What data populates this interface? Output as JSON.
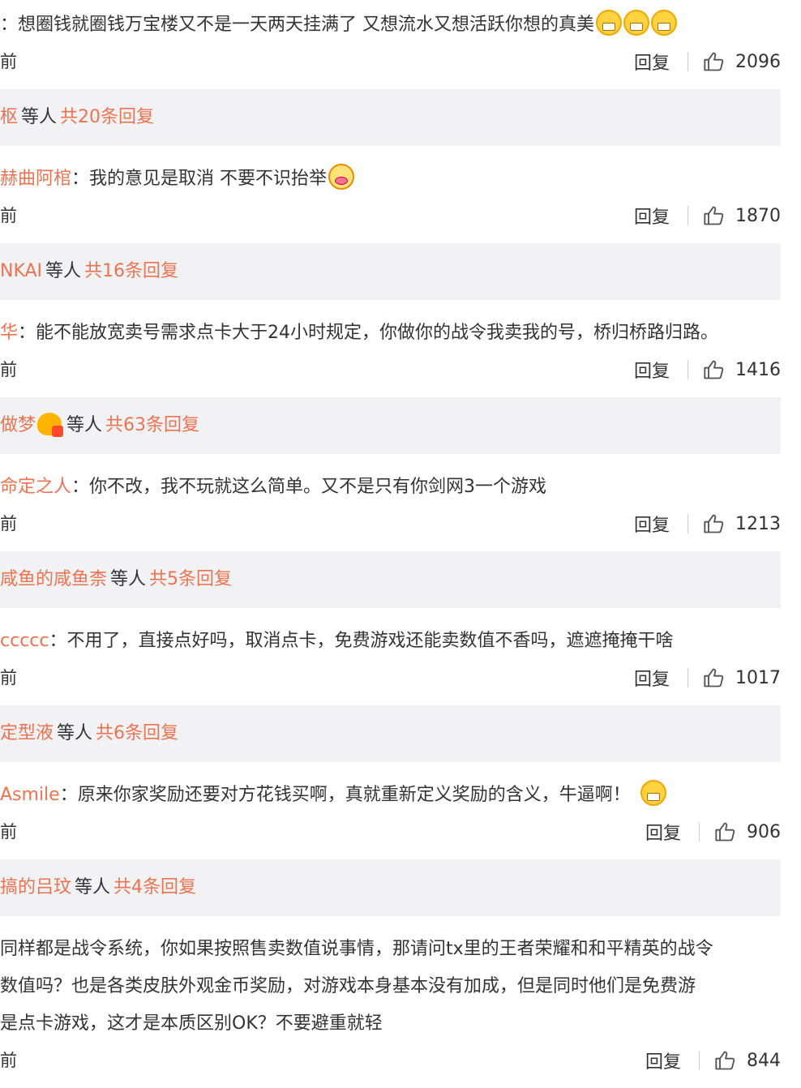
{
  "comments": [
    {
      "name": "",
      "colon": "：",
      "text": "想圈钱就圈钱万宝楼又不是一天两天挂满了 又想流水又想活跃你想的真美",
      "emojis": [
        "grin",
        "grin",
        "grin"
      ],
      "time": "前",
      "reply": "回复",
      "likes": "2096",
      "replies": {
        "name": "枢",
        "mid": "等人",
        "total": "共20条回复"
      }
    },
    {
      "name": "赫曲阿棺",
      "colon": "：",
      "text": "我的意见是取消 不要不识抬举",
      "emojis": [
        "party"
      ],
      "time": "前",
      "reply": "回复",
      "likes": "1870",
      "replies": {
        "name": "NKAI",
        "mid": "等人",
        "total": "共16条回复"
      }
    },
    {
      "name": "华",
      "colon": "：",
      "text": "能不能放宽卖号需求点卡大于24小时规定，你做你的战令我卖我的号，桥归桥路归路。",
      "emojis": [],
      "time": "前",
      "reply": "回复",
      "likes": "1416",
      "replies": {
        "name": "做梦",
        "mid": "等人",
        "total": "共63条回复",
        "badge": "vip-badge-icon"
      }
    },
    {
      "name": "命定之人",
      "colon": "：",
      "text": "你不改，我不玩就这么简单。又不是只有你剑网3一个游戏",
      "emojis": [],
      "time": "前",
      "reply": "回复",
      "likes": "1213",
      "replies": {
        "name": "咸鱼的咸鱼柰",
        "mid": "等人",
        "total": "共5条回复"
      }
    },
    {
      "name": "ccccc",
      "colon": "：",
      "text": "不用了，直接点好吗，取消点卡，免费游戏还能卖数值不香吗，遮遮掩掩干啥",
      "emojis": [],
      "time": "前",
      "reply": "回复",
      "likes": "1017",
      "replies": {
        "name": "定型液",
        "mid": "等人",
        "total": "共6条回复"
      }
    },
    {
      "name": "Asmile",
      "colon": "：",
      "text": "原来你家奖励还要对方花钱买啊，真就重新定义奖励的含义，牛逼啊！",
      "emojis": [
        "grin"
      ],
      "time": "前",
      "reply": "回复",
      "likes": "906",
      "replies": {
        "name": "搞的吕玟",
        "mid": "等人",
        "total": "共4条回复"
      }
    },
    {
      "name": "",
      "colon": "",
      "lines": [
        "同样都是战令系统，你如果按照售卖数值说事情，那请问tx里的王者荣耀和和平精英的战令",
        "数值吗？也是各类皮肤外观金币奖励，对游戏本身基本没有加成，但是同时他们是免费游",
        "是点卡游戏，这才是本质区别OK？不要避重就轻"
      ],
      "emojis": [],
      "time": "前",
      "reply": "回复",
      "likes": "844"
    }
  ],
  "colors": {
    "accent": "#eb7350",
    "reply_bg": "#f2f2f5",
    "text": "#333333"
  }
}
